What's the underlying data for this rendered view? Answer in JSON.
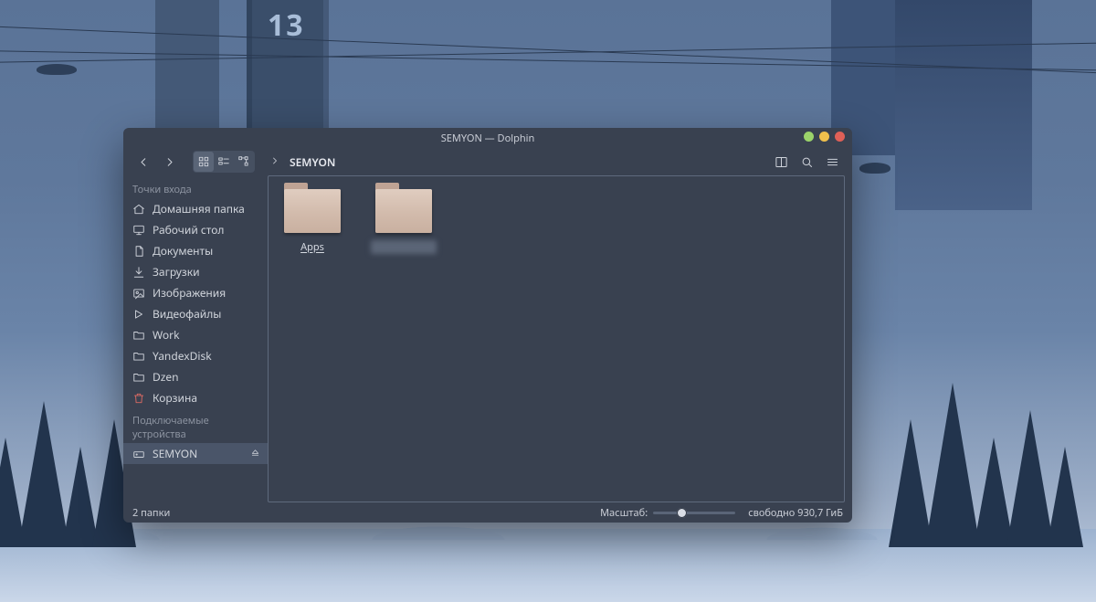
{
  "window": {
    "title": "SEMYON — Dolphin",
    "breadcrumb": {
      "location": "SEMYON"
    }
  },
  "toolbar": {
    "icons": {
      "back": "arrow-left-icon",
      "forward": "arrow-right-icon",
      "icons_view": "grid-icon",
      "compact_view": "compact-icon",
      "details_view": "tree-icon",
      "split": "split-icon",
      "search": "search-icon",
      "menu": "hamburger-icon"
    }
  },
  "sidebar": {
    "section1_label": "Точки входа",
    "items1": [
      {
        "icon": "home-icon",
        "label": "Домашняя папка"
      },
      {
        "icon": "desktop-icon",
        "label": "Рабочий стол"
      },
      {
        "icon": "document-icon",
        "label": "Документы"
      },
      {
        "icon": "download-icon",
        "label": "Загрузки"
      },
      {
        "icon": "image-icon",
        "label": "Изображения"
      },
      {
        "icon": "video-icon",
        "label": "Видеофайлы"
      },
      {
        "icon": "folder-icon",
        "label": "Work"
      },
      {
        "icon": "folder-icon",
        "label": "YandexDisk"
      },
      {
        "icon": "folder-icon",
        "label": "Dzen"
      },
      {
        "icon": "trash-icon",
        "label": "Корзина",
        "red": true
      }
    ],
    "section2_label": "Подключаемые устройства",
    "items2": [
      {
        "icon": "drive-icon",
        "label": "SEMYON",
        "selected": true,
        "ejectable": true
      }
    ]
  },
  "content": {
    "items": [
      {
        "label": "Apps",
        "underline": true
      },
      {
        "label": "██████",
        "blurred": true
      }
    ]
  },
  "status": {
    "count_text": "2 папки",
    "zoom_label": "Масштаб:",
    "zoom_pct": 32,
    "free_space": "свободно 930,7 ГиБ"
  },
  "wallpaper": {
    "sign": "13"
  }
}
